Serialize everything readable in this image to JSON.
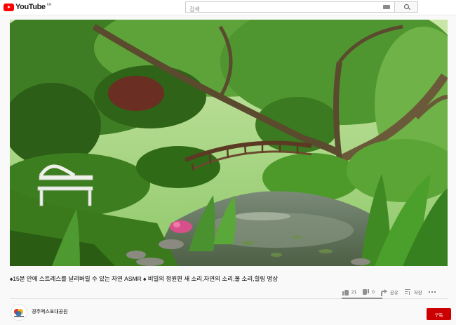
{
  "header": {
    "logo_text": "YouTube",
    "country_code": "KR",
    "search_placeholder": "검색",
    "icons": [
      "youtube-logo-icon",
      "keyboard-icon",
      "search-icon"
    ]
  },
  "video": {
    "title_prefix_icon": "♠",
    "title_part1": "15분 안에 스트레스를 날려버릴 수 있는 자연 ASMR ",
    "title_part2_icon": "♠",
    "title_part2": " 비밀의 정원편 새 소리,자연의 소리,물 소리,힐링 명상",
    "likes": "21",
    "dislikes": "0",
    "share_label": "공유",
    "save_label": "저장",
    "icons": [
      "thumbs-up-icon",
      "thumbs-down-icon",
      "share-icon",
      "save-playlist-icon",
      "more-icon"
    ]
  },
  "channel": {
    "name": "경주엑스포대공원",
    "subscribe_label": "구독"
  },
  "colors": {
    "brand_red": "#ff0000",
    "subscribe_red": "#cc0000",
    "page_bg": "#f9f9f9"
  }
}
